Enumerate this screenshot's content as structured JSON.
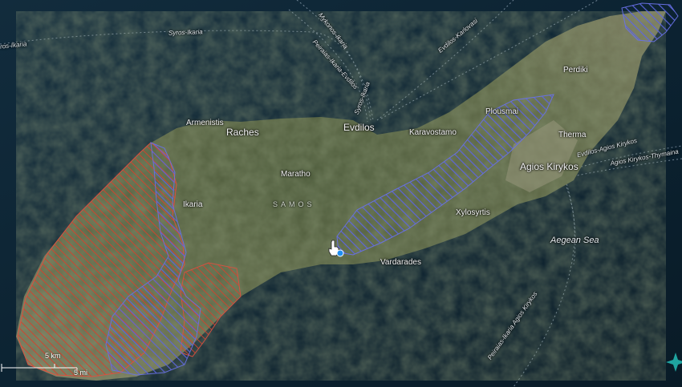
{
  "map": {
    "region_label": "SAMOS",
    "sea_label": "Aegean Sea",
    "towns": {
      "armenistis": "Armenistis",
      "raches": "Raches",
      "evdilos": "Evdilos",
      "karavostamo": "Karavostamo",
      "plousmai": "Plousmai",
      "perdiki": "Perdiki",
      "therma": "Therma",
      "agios_kirykos": "Agios Kirykos",
      "ikaria": "Ikaria",
      "maratho": "Maratho",
      "xylosyrtis": "Xylosyrtis",
      "vardarades": "Vardarades"
    },
    "ferry_routes": {
      "syros_ikaria_west": "Syros-Ikaria",
      "syros_ikaria_left": "ros-Ikaria",
      "mykonos_ikaria": "Mykonos-Ikaria",
      "piraeus_ikaria_evdilos": "Peiraias-Ikaria-Evdilos",
      "syros_ikaria_north": "Syros-Ikaria",
      "evdilos_karlovasi": "Evdilos-Karlovasi",
      "evdilos_agios_kirykos": "Evdilos-Agios Kirykos",
      "agios_kirykos_thymaina": "Agios Kirykos-Thymaina",
      "piraeus_ikaria_agios_kirykos": "Peiraias-Ikaria Agios Kirykos"
    },
    "scale": {
      "upper_label": "5 km",
      "lower_label": "5 mi"
    },
    "colors": {
      "sea": "#0d2433",
      "land": "#556142",
      "red_hatch": "#c8412f",
      "blue_hatch": "#5a64d8",
      "route_line": "#8fa2b3"
    }
  }
}
